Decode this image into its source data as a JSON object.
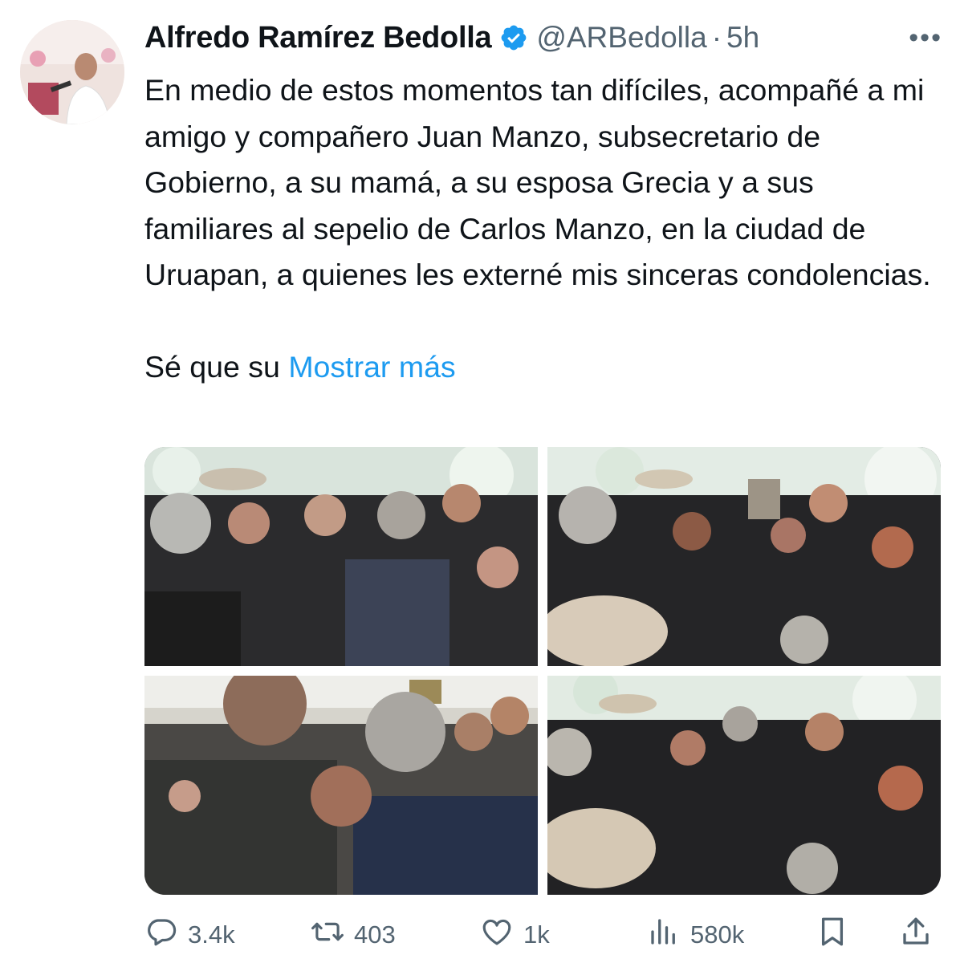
{
  "tweet": {
    "author_name": "Alfredo Ramírez Bedolla",
    "handle": "@ARBedolla",
    "separator": "·",
    "time": "5h",
    "more_label": "•••",
    "text_paragraph_1": "En medio de estos momentos tan difíciles, acompañé a mi amigo y compañero Juan Manzo, subsecretario de Gobierno, a su mamá, a su esposa Grecia y a sus familiares al sepelio de Carlos Manzo, en la ciudad de Uruapan, a quienes les externé mis sinceras condolencias.",
    "text_paragraph_2": "Sé que su",
    "show_more_label": "Mostrar más"
  },
  "actions": {
    "replies": "3.4k",
    "reposts": "403",
    "likes": "1k",
    "views": "580k"
  },
  "icons": {
    "verified": "verified-badge-icon",
    "reply": "reply-icon",
    "repost": "repost-icon",
    "like": "heart-icon",
    "views": "views-icon",
    "bookmark": "bookmark-icon",
    "share": "share-icon"
  },
  "colors": {
    "accent": "#1d9bf0",
    "text": "#0f1419",
    "secondary": "#536471"
  }
}
